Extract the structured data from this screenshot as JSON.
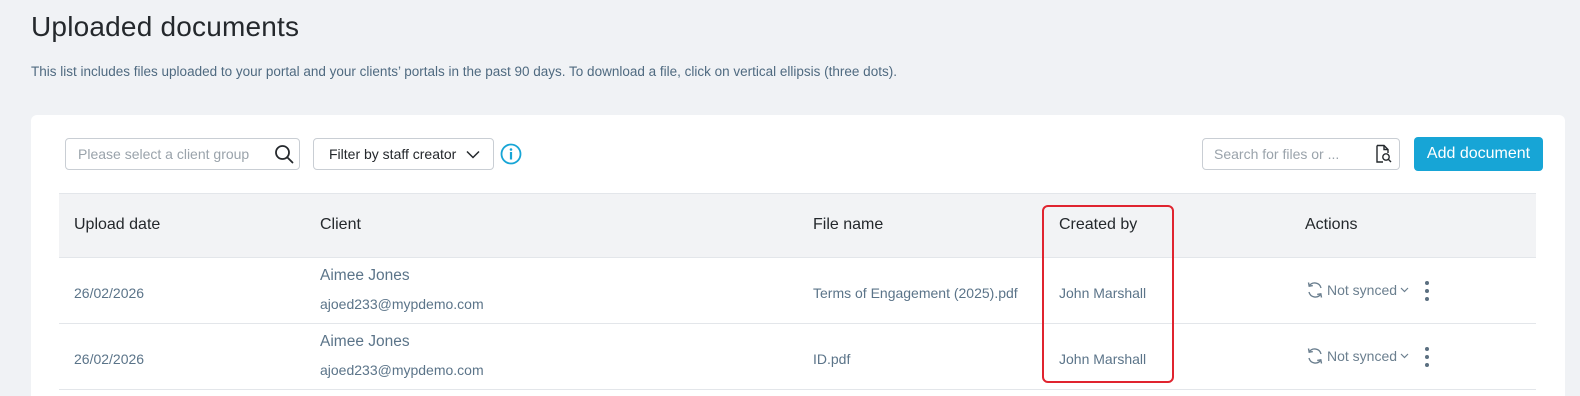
{
  "page": {
    "title": "Uploaded documents",
    "description": "This list includes files uploaded to your portal and your clients’ portals in the past 90 days. To download a file, click on vertical ellipsis (three dots)."
  },
  "toolbar": {
    "client_group_placeholder": "Please select a client group",
    "staff_filter_label": "Filter by staff creator",
    "file_search_placeholder": "Search for files or ...",
    "add_document_label": "Add document"
  },
  "table": {
    "columns": [
      "Upload date",
      "Client",
      "File name",
      "Created by",
      "Actions"
    ],
    "rows": [
      {
        "upload_date": "26/02/2026",
        "client_name": "Aimee Jones",
        "client_email": "ajoed233@mypdemo.com",
        "file_name": "Terms of Engagement (2025).pdf",
        "created_by": "John Marshall",
        "sync_status": "Not synced"
      },
      {
        "upload_date": "26/02/2026",
        "client_name": "Aimee Jones",
        "client_email": "ajoed233@mypdemo.com",
        "file_name": "ID.pdf",
        "created_by": "John Marshall",
        "sync_status": "Not synced"
      }
    ]
  },
  "colors": {
    "accent": "#17a5d6",
    "highlight": "#e0242f",
    "background": "#f0f2f5"
  },
  "icons": {
    "client_search": "search-icon",
    "staff_filter": "chevron-down-icon",
    "info": "info-icon",
    "file_search": "file-search-icon",
    "sync": "sync-icon",
    "more": "more-vertical-icon"
  }
}
